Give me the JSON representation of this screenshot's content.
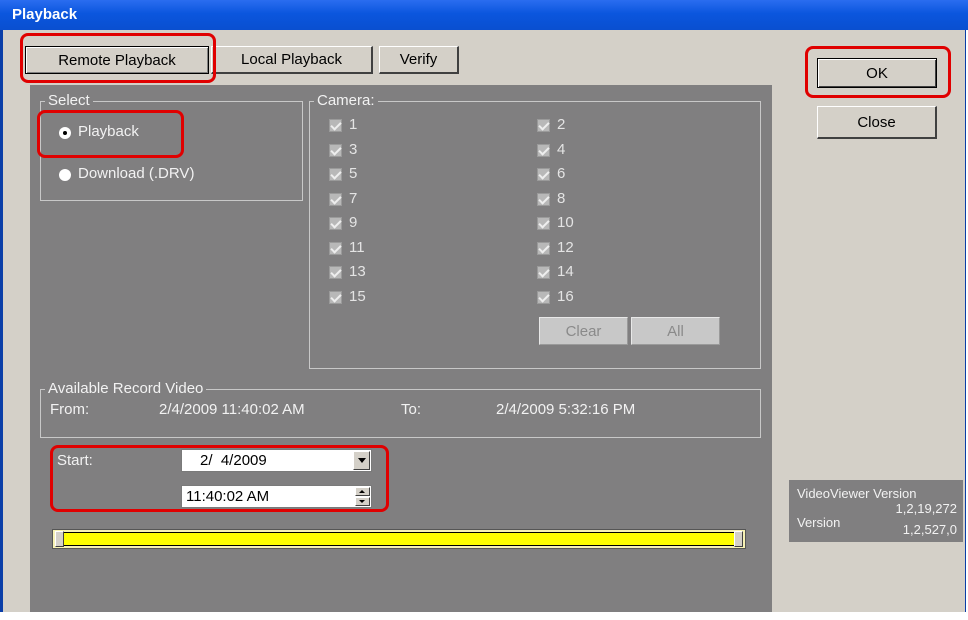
{
  "window": {
    "title": "Playback"
  },
  "tabs": [
    {
      "label": "Remote Playback",
      "active": true
    },
    {
      "label": "Local Playback",
      "active": false
    },
    {
      "label": "Verify",
      "active": false
    }
  ],
  "actions": {
    "ok_label": "OK",
    "close_label": "Close"
  },
  "select_group": {
    "legend": "Select",
    "options": [
      {
        "label": "Playback",
        "selected": true
      },
      {
        "label": "Download (.DRV)",
        "selected": false
      }
    ]
  },
  "camera_group": {
    "legend": "Camera:",
    "cameras": [
      "1",
      "2",
      "3",
      "4",
      "5",
      "6",
      "7",
      "8",
      "9",
      "10",
      "11",
      "12",
      "13",
      "14",
      "15",
      "16"
    ],
    "all_checked": true,
    "clear_label": "Clear",
    "all_label": "All"
  },
  "record_group": {
    "legend": "Available Record Video",
    "from_label": "From:",
    "from_value": "2/4/2009 11:40:02 AM",
    "to_label": "To:",
    "to_value": "2/4/2009 5:32:16 PM"
  },
  "start": {
    "label": "Start:",
    "date_value": "2/  4/2009",
    "time_value": "11:40:02 AM"
  },
  "timeline": {
    "position": 0.0
  },
  "version": {
    "videoviewer_label": "VideoViewer Version",
    "videoviewer_value": "1,2,19,272",
    "version_label": "Version",
    "version_value": "1,2,527,0"
  },
  "colors": {
    "highlight": "#e00000",
    "timeline_fill": "#ffff00",
    "titlebar": "#0b56de"
  }
}
